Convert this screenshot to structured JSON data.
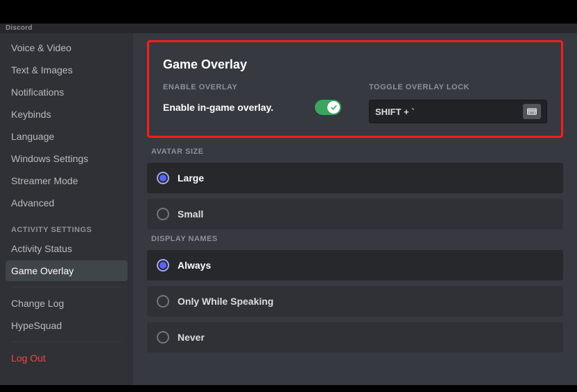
{
  "titlebar": "Discord",
  "sidebar": {
    "items_top": [
      {
        "label": "Voice & Video"
      },
      {
        "label": "Text & Images"
      },
      {
        "label": "Notifications"
      },
      {
        "label": "Keybinds"
      },
      {
        "label": "Language"
      },
      {
        "label": "Windows Settings"
      },
      {
        "label": "Streamer Mode"
      },
      {
        "label": "Advanced"
      }
    ],
    "activity_header": "ACTIVITY SETTINGS",
    "activity_items": [
      {
        "label": "Activity Status"
      },
      {
        "label": "Game Overlay",
        "selected": true
      }
    ],
    "items_bottom": [
      {
        "label": "Change Log"
      },
      {
        "label": "HypeSquad"
      }
    ],
    "logout": "Log Out"
  },
  "page": {
    "title": "Game Overlay",
    "enable_label": "ENABLE OVERLAY",
    "enable_text": "Enable in-game overlay.",
    "toggle_on": true,
    "lock_label": "TOGGLE OVERLAY LOCK",
    "keybind": "SHIFT + `"
  },
  "avatar_size": {
    "label": "AVATAR SIZE",
    "options": [
      "Large",
      "Small"
    ],
    "selected": 0
  },
  "display_names": {
    "label": "DISPLAY NAMES",
    "options": [
      "Always",
      "Only While Speaking",
      "Never"
    ],
    "selected": 0
  }
}
